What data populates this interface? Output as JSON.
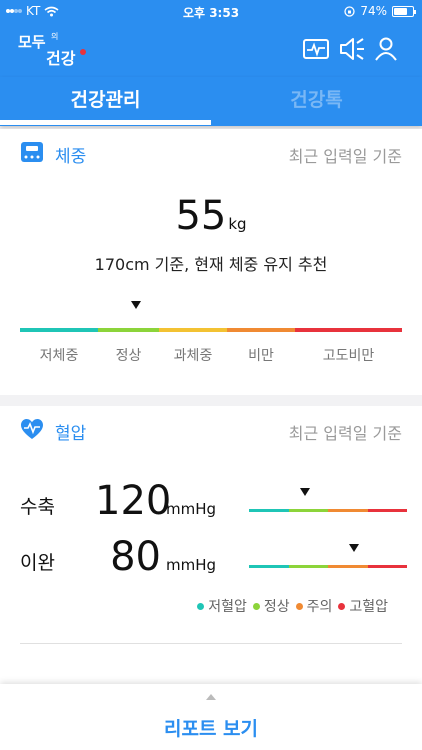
{
  "status_bar": {
    "carrier": "KT",
    "time": "오후 3:53",
    "battery": "74%",
    "battery_level": 0.74
  },
  "header": {
    "logo_text": "모두의 건강",
    "icons": [
      "pulse-monitor-icon",
      "speaker-icon",
      "user-icon"
    ]
  },
  "tabs": [
    {
      "label": "건강관리",
      "active": true
    },
    {
      "label": "건강톡",
      "active": false
    }
  ],
  "weight": {
    "title": "체중",
    "meta": "최근 입력일 기준",
    "value": "55",
    "unit": "kg",
    "recommendation": "170cm 기준, 현재 체중 유지 추천",
    "scale": [
      {
        "label": "저체중",
        "color": "#1fc5b6"
      },
      {
        "label": "정상",
        "color": "#8cd43a"
      },
      {
        "label": "과체중",
        "color": "#f3c233"
      },
      {
        "label": "비만",
        "color": "#f08a33"
      },
      {
        "label": "고도비만",
        "color": "#e8323c"
      }
    ],
    "pointer_category": "정상"
  },
  "blood_pressure": {
    "title": "혈압",
    "meta": "최근 입력일 기준",
    "systolic": {
      "label": "수축",
      "value": "120",
      "unit": "mmHg"
    },
    "diastolic": {
      "label": "이완",
      "value": "80",
      "unit": "mmHg"
    },
    "legend": [
      {
        "label": "저혈압",
        "color": "#1fc5b6"
      },
      {
        "label": "정상",
        "color": "#8cd43a"
      },
      {
        "label": "주의",
        "color": "#f08a33"
      },
      {
        "label": "고혈압",
        "color": "#e8323c"
      }
    ]
  },
  "footer": {
    "report_button": "리포트 보기"
  }
}
